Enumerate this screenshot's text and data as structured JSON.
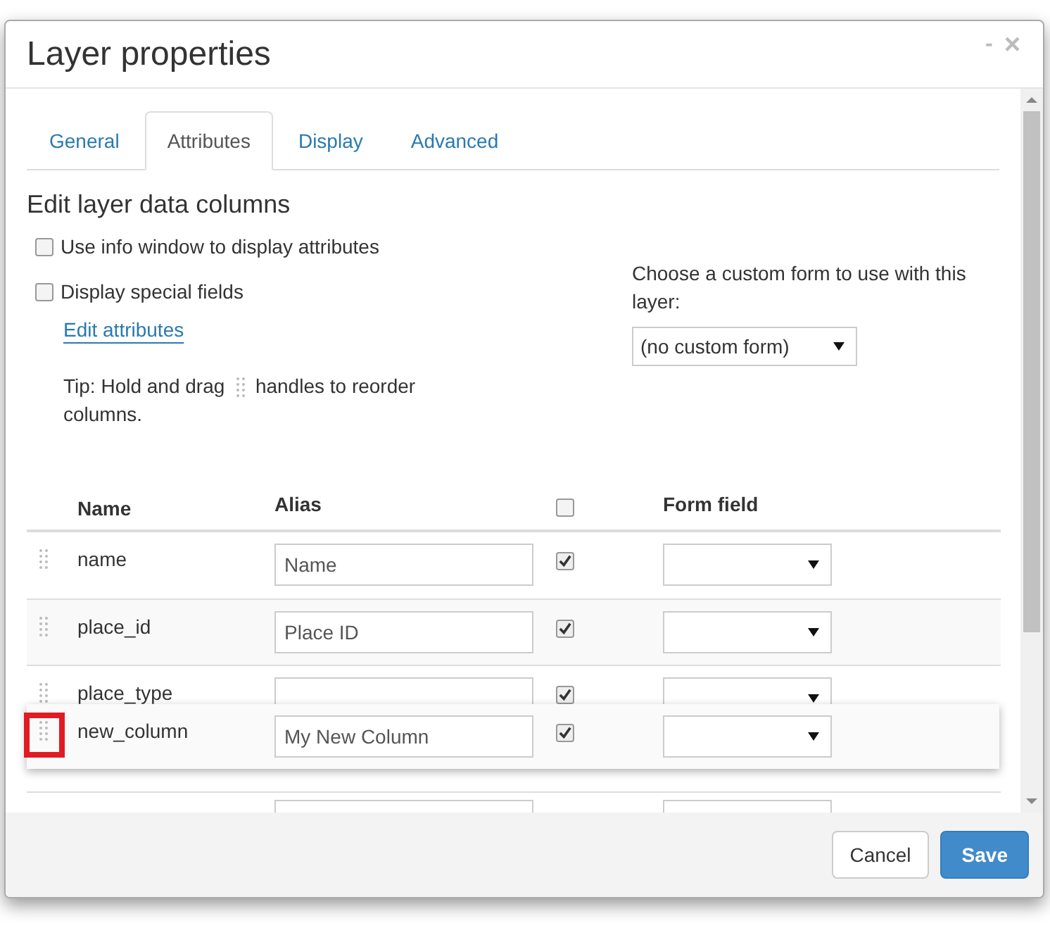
{
  "window": {
    "title": "Layer properties",
    "minimize": "-",
    "close": "×"
  },
  "tabs": [
    {
      "label": "General",
      "selected": false
    },
    {
      "label": "Attributes",
      "selected": true
    },
    {
      "label": "Display",
      "selected": false
    },
    {
      "label": "Advanced",
      "selected": false
    }
  ],
  "section_title": "Edit layer data columns",
  "options": [
    {
      "label": "Use info window to display attributes",
      "checked": false
    },
    {
      "label": "Display special fields",
      "checked": false
    }
  ],
  "edit_link": "Edit attributes",
  "tip": {
    "before": "Tip: Hold and drag",
    "after": "handles to reorder",
    "after_line_2": "columns."
  },
  "custom_form": {
    "label": "Choose a custom form to use with this layer:",
    "value": "(no custom form)"
  },
  "table": {
    "columns": {
      "name": "Name",
      "alias": "Alias",
      "all_visible": false,
      "form_field": "Form field"
    },
    "rows": [
      {
        "name": "name",
        "alias": "Name",
        "visible": true
      },
      {
        "name": "place_id",
        "alias": "Place ID",
        "visible": true
      },
      {
        "name": "place_type",
        "visible": true,
        "covered": true
      }
    ],
    "dragged_row": {
      "name": "new_column",
      "alias": "My New Column",
      "visible": true,
      "highlighted": true
    }
  },
  "buttons": {
    "cancel": "Cancel",
    "save": "Save"
  }
}
